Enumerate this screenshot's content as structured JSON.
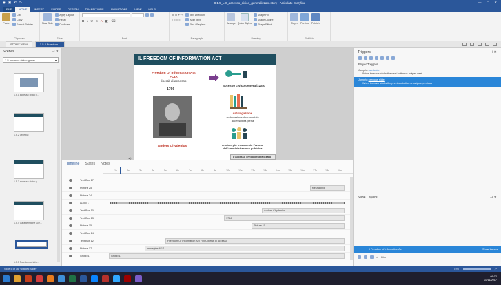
{
  "window": {
    "title": "8.1.5_LO_accesso_civico_generalizzato.story - Articulate Storyline"
  },
  "menu": [
    "FILE",
    "HOME",
    "INSERT",
    "SLIDES",
    "DESIGN",
    "TRANSITIONS",
    "ANIMATIONS",
    "VIEW",
    "HELP"
  ],
  "ribbon": {
    "clipboard": {
      "label": "Clipboard",
      "paste": "Paste",
      "cut": "Cut",
      "copy": "Copy",
      "format_painter": "Format Painter"
    },
    "slide": {
      "label": "Slide",
      "new_slide": "New Slide",
      "apply_layout": "Apply Layout",
      "reset": "Reset",
      "duplicate": "Duplicate"
    },
    "font": {
      "label": "Font",
      "font_name": "",
      "font_size": ""
    },
    "paragraph": {
      "label": "Paragraph",
      "text_direction": "Text Direction",
      "align_text": "Align Text",
      "find_replace": "Find / Replace"
    },
    "drawing": {
      "label": "Drawing",
      "arrange": "Arrange",
      "quick_styles": "Quick Styles",
      "shape_fill": "Shape Fill",
      "shape_outline": "Shape Outline",
      "shape_effect": "Shape Effect"
    },
    "publish": {
      "label": "Publish",
      "player": "Player",
      "preview": "Preview",
      "publish": "Publish"
    }
  },
  "tabs": {
    "story_view": "STORY VIEW",
    "slide_tab": "1.5.4 Freedom..."
  },
  "scenes": {
    "title": "Scenes",
    "selector": "1.5 accesso civico gener",
    "slides": [
      {
        "label": "1.5.1 accesso civico g..."
      },
      {
        "label": "1.5.2 Obiettivi"
      },
      {
        "label": "1.5.3 accesso civico g..."
      },
      {
        "label": "1.5.4 Caratteristiche ace..."
      },
      {
        "label": "1.5.5 Freedom of info..."
      }
    ]
  },
  "slide": {
    "banner": "IL FREEDOM OF INFORMATION ACT",
    "left_heading": "Freedom Of Information Act",
    "foia": "FOIA",
    "liberta": "libertà di accesso",
    "year": "1766",
    "person": "Anders Chydenius",
    "right_label": "accesso civico generalizzato",
    "catalog_title": "catalogazione",
    "catalog_text1": "archiviazione documentale",
    "catalog_text2": "accessibilità piena",
    "transp_text1": "rendere più trasparente l'azione",
    "transp_text2": "dell'amministrazione pubblica",
    "bottom_tag": "L'accesso civico generalizzato"
  },
  "timeline": {
    "tabs": [
      "Timeline",
      "States",
      "Notes"
    ],
    "ticks": [
      "1s",
      "2s",
      "3s",
      "4s",
      "5s",
      "6s",
      "7s",
      "8s",
      "9s",
      "10s",
      "11s",
      "12s",
      "13s",
      "14s",
      "15s",
      "16s",
      "17s",
      "18s",
      "19s"
    ],
    "rows": [
      {
        "name": "Text Box 17",
        "bar": ""
      },
      {
        "name": "Picture 25",
        "bar": "filesna.png"
      },
      {
        "name": "Picture 24",
        "bar": ""
      },
      {
        "name": "Audio 1",
        "bar": ""
      },
      {
        "name": "Text Box 10",
        "bar": "Anders Chydenius"
      },
      {
        "name": "Text Box 13",
        "bar": "1766"
      },
      {
        "name": "Picture 15",
        "bar": "Picture 15"
      },
      {
        "name": "Text Box 14",
        "bar": ""
      },
      {
        "name": "Text Box 12",
        "bar": "Freedom Of Information Act FOIA libertà di accesso"
      },
      {
        "name": "Picture 17",
        "bar": "Immagine 6 17"
      },
      {
        "name": "Group 1",
        "bar": "Group 1"
      }
    ]
  },
  "triggers": {
    "title": "Triggers",
    "section": "Player Triggers",
    "items": [
      {
        "action": "Jump to",
        "link": "next slide",
        "desc": "When the user clicks the next button or swipes next"
      },
      {
        "action": "Jump to",
        "link": "previous slide",
        "desc": "When the user clicks the previous button or swipes previous"
      }
    ]
  },
  "layers": {
    "title": "Slide Layers",
    "base_layer": "Il Freedom of Information Act",
    "show_layers": "Show Layers",
    "dim": "Dim"
  },
  "status": {
    "left": "Slide 5 of 16   \"Untitled Slide\"",
    "zoom": "75%"
  },
  "taskbar": {
    "time": "09:02",
    "date": "02/11/2017"
  }
}
